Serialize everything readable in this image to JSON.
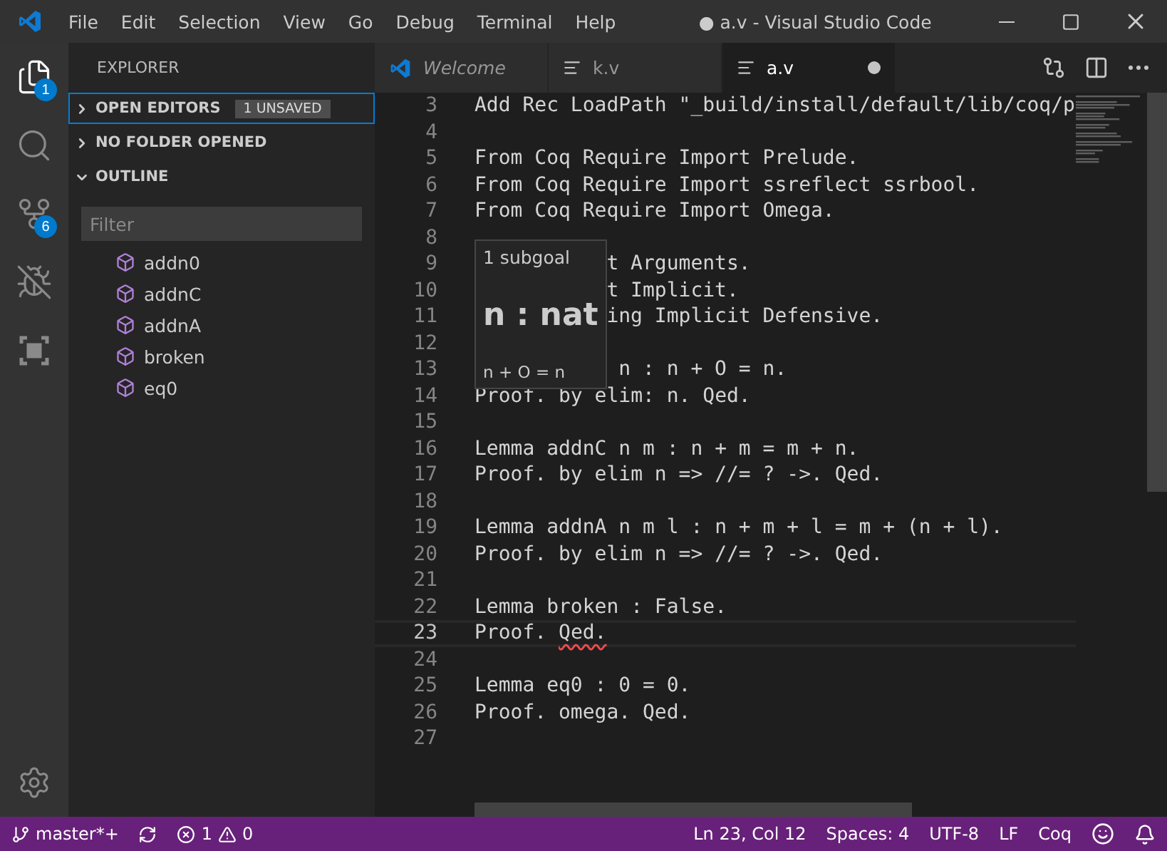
{
  "title_bar": {
    "menus": [
      "File",
      "Edit",
      "Selection",
      "View",
      "Go",
      "Debug",
      "Terminal",
      "Help"
    ],
    "title": "● a.v - Visual Studio Code"
  },
  "activity_bar": {
    "items": [
      {
        "kind": "files",
        "badge": "1",
        "selected": true
      },
      {
        "kind": "search",
        "selected": false
      },
      {
        "kind": "source-control",
        "badge": "6",
        "selected": false
      },
      {
        "kind": "debug",
        "selected": false
      },
      {
        "kind": "extensions",
        "selected": false
      }
    ]
  },
  "sidebar": {
    "title": "EXPLORER",
    "sections": [
      {
        "label": "OPEN EDITORS",
        "badge": "1 UNSAVED",
        "expanded": false,
        "focused": true
      },
      {
        "label": "NO FOLDER OPENED",
        "expanded": false,
        "focused": false
      },
      {
        "label": "OUTLINE",
        "expanded": true,
        "focused": false
      }
    ],
    "filter": {
      "placeholder": "Filter"
    },
    "outline": [
      "addn0",
      "addnC",
      "addnA",
      "broken",
      "eq0"
    ]
  },
  "tabs": [
    {
      "label": "Welcome",
      "kind": "welcome",
      "selected": false,
      "preview": true,
      "dirty": false
    },
    {
      "label": "k.v",
      "kind": "file",
      "selected": false,
      "preview": false,
      "dirty": false
    },
    {
      "label": "a.v",
      "kind": "file",
      "selected": true,
      "preview": false,
      "dirty": true
    }
  ],
  "editor": {
    "lines": [
      {
        "number": "3",
        "text": "Add Rec LoadPath \"_build/install/default/lib/coq/p"
      },
      {
        "number": "4"
      },
      {
        "number": "5",
        "text": "From Coq Require Import Prelude."
      },
      {
        "number": "6",
        "text": "From Coq Require Import ssreflect ssrbool."
      },
      {
        "number": "7",
        "text": "From Coq Require Import Omega."
      },
      {
        "number": "8"
      },
      {
        "number": "9",
        "text": "t Arguments.",
        "covered": true
      },
      {
        "number": "10",
        "text": "t Implicit.",
        "covered": true
      },
      {
        "number": "11",
        "text": "ing Implicit Defensive.",
        "covered": true
      },
      {
        "number": "12",
        "covered": true
      },
      {
        "number": "13",
        "text": " n : n + O = n.",
        "covered": true
      },
      {
        "number": "14",
        "text": "Proof. by elim: n. Qed."
      },
      {
        "number": "15"
      },
      {
        "number": "16",
        "text": "Lemma addnC n m : n + m = m + n."
      },
      {
        "number": "17",
        "text": "Proof. by elim n => //= ? ->. Qed."
      },
      {
        "number": "18"
      },
      {
        "number": "19",
        "text": "Lemma addnA n m l : n + m + l = m + (n + l)."
      },
      {
        "number": "20",
        "text": "Proof. by elim n => //= ? ->. Qed."
      },
      {
        "number": "21"
      },
      {
        "number": "22",
        "text": "Lemma broken : False."
      },
      {
        "number": "23",
        "text": "Proof. ",
        "error_text": "Qed.",
        "current": true
      },
      {
        "number": "24"
      },
      {
        "number": "25",
        "text": "Lemma eq0 : 0 = 0."
      },
      {
        "number": "26",
        "text": "Proof. omega. Qed."
      },
      {
        "number": "27"
      }
    ],
    "hover": {
      "header": "1 subgoal",
      "hypothesis": "n : nat",
      "goal": "n + O = n"
    }
  },
  "status_bar": {
    "branch": "master*+",
    "errors": "1",
    "warnings": "0",
    "items": [
      "Ln 23, Col 12",
      "Spaces: 4",
      "UTF-8",
      "LF",
      "Coq"
    ]
  }
}
